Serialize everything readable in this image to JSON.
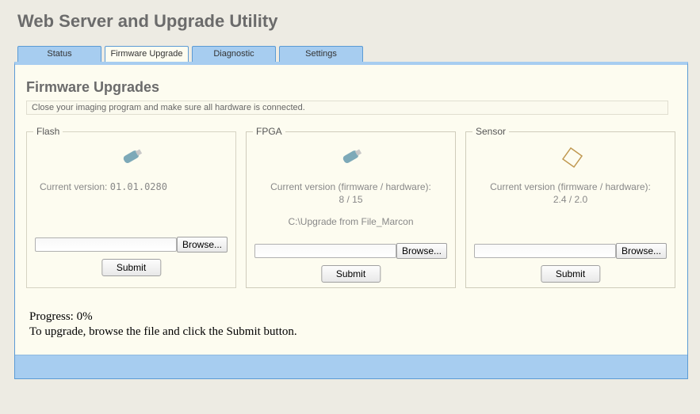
{
  "page_title": "Web Server and Upgrade Utility",
  "tabs": {
    "status": "Status",
    "firmware": "Firmware Upgrade",
    "diagnostic": "Diagnostic",
    "settings": "Settings"
  },
  "section_title": "Firmware Upgrades",
  "instructions": "Close your imaging program and make sure all hardware is connected.",
  "cards": {
    "flash": {
      "legend": "Flash",
      "version_label": "Current version:",
      "version_value": "01.01.0280",
      "file_value": "",
      "browse": "Browse...",
      "submit": "Submit"
    },
    "fpga": {
      "legend": "FPGA",
      "version_label": "Current version (firmware / hardware):",
      "version_value": "8 / 15",
      "file_value": "C:\\Upgrade from File_Marcon",
      "browse": "Browse...",
      "submit": "Submit"
    },
    "sensor": {
      "legend": "Sensor",
      "version_label": "Current version (firmware / hardware):",
      "version_value": "2.4 / 2.0",
      "file_value": "",
      "browse": "Browse...",
      "submit": "Submit"
    }
  },
  "progress": {
    "label": "Progress: 0%",
    "hint": "To upgrade, browse the file and click the Submit button."
  }
}
